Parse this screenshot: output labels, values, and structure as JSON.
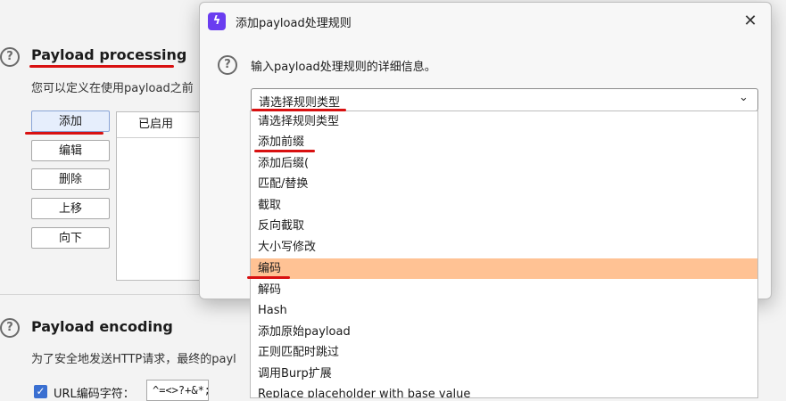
{
  "background": {
    "processing": {
      "title": "Payload processing",
      "description": "您可以定义在使用payload之前",
      "buttons": [
        "添加",
        "编辑",
        "删除",
        "上移",
        "向下"
      ],
      "table_header": "已启用"
    },
    "encoding": {
      "title": "Payload encoding",
      "description": "为了安全地发送HTTP请求，最终的payl",
      "url_checkbox_label": "URL编码字符：",
      "url_chars": "^=<>?+&*;:\"{}|^"
    }
  },
  "dialog": {
    "title": "添加payload处理规则",
    "description": "输入payload处理规则的详细信息。",
    "close_glyph": "✕",
    "select": {
      "value": "请选择规则类型",
      "chevron": "⌄"
    }
  },
  "dropdown": {
    "options": [
      "请选择规则类型",
      "添加前缀",
      "添加后缀(",
      "匹配/替换",
      "截取",
      "反向截取",
      "大小写修改",
      "编码",
      "解码",
      "Hash",
      "添加原始payload",
      "正则匹配时跳过",
      "调用Burp扩展",
      "Replace placeholder with base value"
    ],
    "highlighted": "编码"
  },
  "colors": {
    "highlight": "#ffc294",
    "annotation": "#d81010",
    "burp_logo": "#6a3df0",
    "checkbox": "#3a6fd1"
  }
}
